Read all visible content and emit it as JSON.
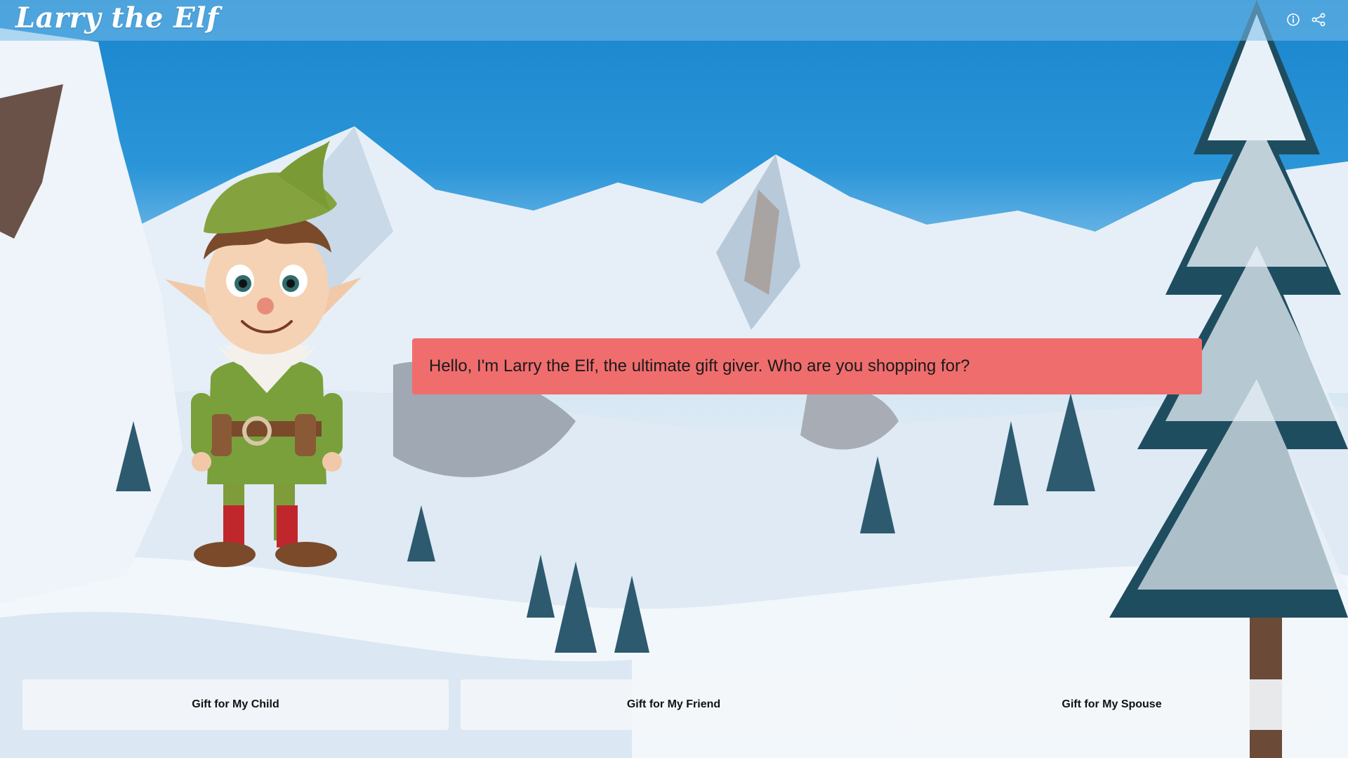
{
  "app": {
    "title": "Larry the Elf"
  },
  "header": {
    "icons": [
      "info-icon",
      "share-icon"
    ]
  },
  "dialog": {
    "message": "Hello, I'm Larry the Elf, the ultimate gift giver. Who are you shopping for?"
  },
  "choices": [
    {
      "label": "Gift for My Child"
    },
    {
      "label": "Gift for My Friend"
    },
    {
      "label": "Gift for My Spouse"
    }
  ],
  "colors": {
    "speech_bubble": "#f06d6d",
    "sky": "#1a85cc",
    "button_bg": "#f3f6fa"
  }
}
